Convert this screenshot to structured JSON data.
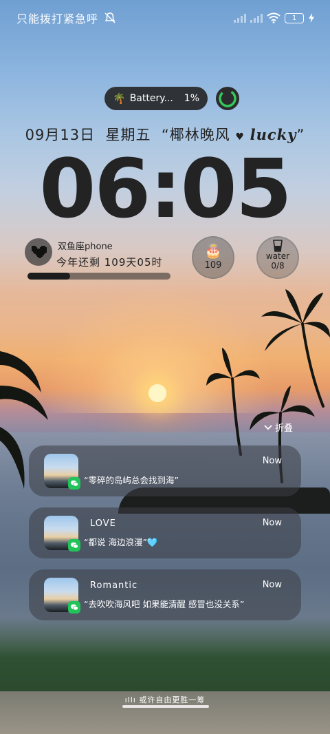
{
  "status_bar": {
    "carrier_text": "只能拨打紧急呼",
    "battery_level": "1"
  },
  "battery_widget": {
    "icon": "palm-tree-icon",
    "name": "Battery...",
    "percent": "1%"
  },
  "lockscreen": {
    "date": "09月13日",
    "weekday": "星期五",
    "signature_prefix": "“椰林晚风",
    "signature_lucky": "lucky",
    "signature_suffix": "”",
    "time": "06:05"
  },
  "profile_widget": {
    "name": "双鱼座phone",
    "remaining": "今年还剩 109天05时",
    "progress_fraction": 0.3
  },
  "countdown_widget": {
    "icon": "cake-icon",
    "value": "109"
  },
  "water_widget": {
    "label": "water",
    "count": "0/8"
  },
  "notifications": {
    "fold_label": "折叠",
    "items": [
      {
        "title": "",
        "time": "Now",
        "message": "“零碎的岛屿总会找到海”"
      },
      {
        "title": "LOVE",
        "time": "Now",
        "message": "“都说 海边浪漫”🩵"
      },
      {
        "title": "Romantic",
        "time": "Now",
        "message": "“去吹吹海风吧 如果能清醒 感冒也没关系”"
      }
    ]
  },
  "bottom": {
    "hint": "或许自由更胜一筹"
  }
}
